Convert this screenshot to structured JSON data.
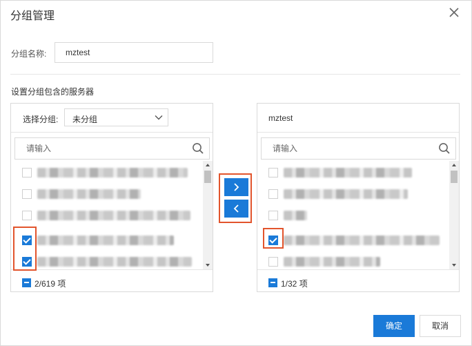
{
  "dialog": {
    "title": "分组管理",
    "name_label": "分组名称:",
    "name_value": "mztest",
    "section_label": "设置分组包含的服务器",
    "ok_label": "确定",
    "cancel_label": "取消"
  },
  "left_panel": {
    "group_label": "选择分组:",
    "group_value": "未分组",
    "search_placeholder": "请输入",
    "count": "2/619 项",
    "items": [
      {
        "checked": false
      },
      {
        "checked": false
      },
      {
        "checked": false
      },
      {
        "checked": true
      },
      {
        "checked": true
      }
    ]
  },
  "right_panel": {
    "title": "mztest",
    "search_placeholder": "请输入",
    "count": "1/32 项",
    "items": [
      {
        "checked": false
      },
      {
        "checked": false
      },
      {
        "checked": false
      },
      {
        "checked": true
      },
      {
        "checked": false
      }
    ]
  },
  "icons": {
    "close": "close-icon",
    "search": "search-icon",
    "move_right": "chevron-right-icon",
    "move_left": "chevron-left-icon",
    "select_dropdown": "chevron-down-icon"
  },
  "colors": {
    "accent": "#1a7ad8",
    "highlight": "#e2542c"
  }
}
